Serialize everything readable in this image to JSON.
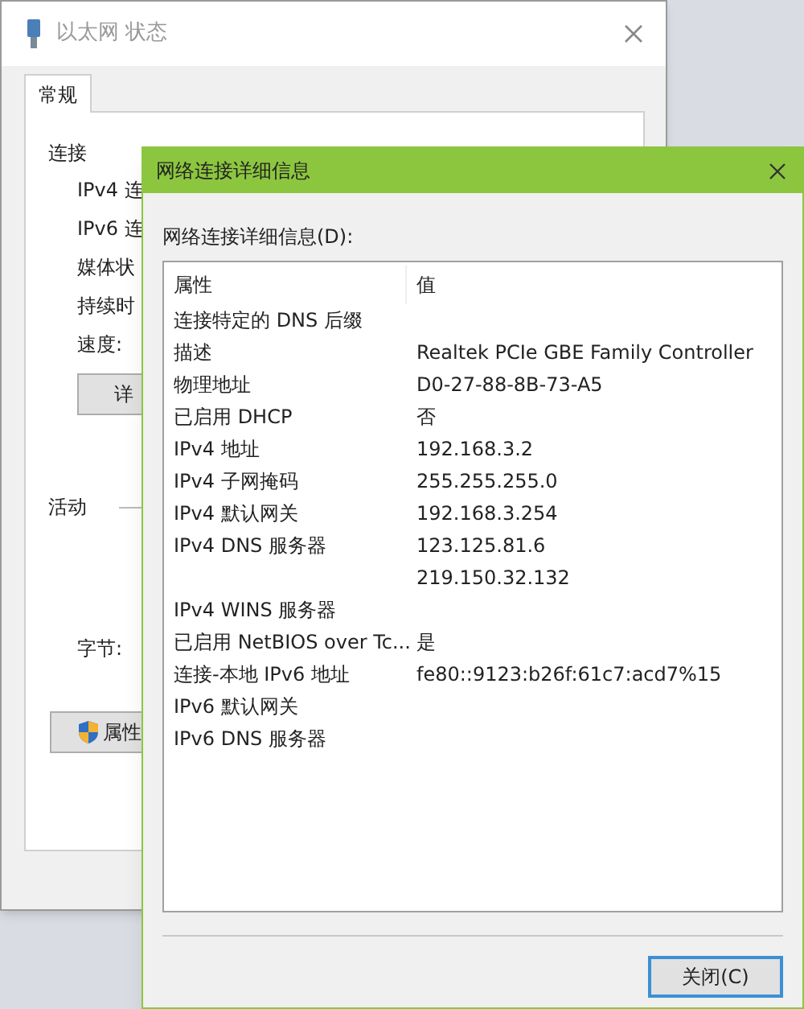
{
  "status_window": {
    "title": "以太网 状态",
    "tabs": [
      {
        "label": "常规",
        "selected": true
      }
    ],
    "section_connection": "连接",
    "connection_labels": [
      "IPv4 连",
      "IPv6 连",
      "媒体状",
      "持续时",
      "速度:"
    ],
    "details_button": "详",
    "section_activity": "活动",
    "bytes_label": "字节:",
    "properties_button": "属性"
  },
  "details_dialog": {
    "title": "网络连接详细信息",
    "list_label": "网络连接详细信息(D):",
    "columns": [
      "属性",
      "值"
    ],
    "rows": [
      {
        "property": "连接特定的 DNS 后缀"
      },
      {
        "property": "描述",
        "value": "Realtek PCIe GBE Family Controller"
      },
      {
        "property": "物理地址",
        "value": "D0-27-88-8B-73-A5"
      },
      {
        "property": "已启用 DHCP",
        "value": "否"
      },
      {
        "property": "IPv4 地址",
        "value": "192.168.3.2"
      },
      {
        "property": "IPv4 子网掩码",
        "value": "255.255.255.0"
      },
      {
        "property": "IPv4 默认网关",
        "value": "192.168.3.254"
      },
      {
        "property": "IPv4 DNS 服务器",
        "value": "123.125.81.6"
      },
      {
        "value": "219.150.32.132"
      },
      {
        "property": "IPv4 WINS 服务器"
      },
      {
        "property": "已启用 NetBIOS over Tc...",
        "value": "是"
      },
      {
        "property": "连接-本地 IPv6 地址",
        "value": "fe80::9123:b26f:61c7:acd7%15"
      },
      {
        "property": "IPv6 默认网关"
      },
      {
        "property": "IPv6 DNS 服务器"
      }
    ],
    "close_button": "关闭(C)"
  }
}
